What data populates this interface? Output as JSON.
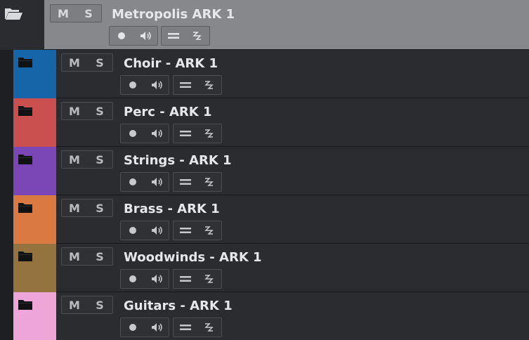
{
  "parent": {
    "name": "Metropolis ARK 1",
    "mute_label": "M",
    "solo_label": "S",
    "icon": "folder-open-icon"
  },
  "tracks": [
    {
      "name": "Choir - ARK 1",
      "mute_label": "M",
      "solo_label": "S",
      "color": "#1565a8",
      "icon": "folder-icon"
    },
    {
      "name": "Perc - ARK 1",
      "mute_label": "M",
      "solo_label": "S",
      "color": "#c9504f",
      "icon": "folder-icon"
    },
    {
      "name": "Strings - ARK 1",
      "mute_label": "M",
      "solo_label": "S",
      "color": "#7b46b5",
      "icon": "folder-icon"
    },
    {
      "name": "Brass - ARK 1",
      "mute_label": "M",
      "solo_label": "S",
      "color": "#da7a42",
      "icon": "folder-icon"
    },
    {
      "name": "Woodwinds - ARK 1",
      "mute_label": "M",
      "solo_label": "S",
      "color": "#95733f",
      "icon": "folder-icon"
    },
    {
      "name": "Guitars - ARK 1",
      "mute_label": "M",
      "solo_label": "S",
      "color": "#eda6d7",
      "icon": "folder-icon"
    }
  ],
  "colors": {
    "parent_bg": "#86888b",
    "row_bg": "#2a2c30",
    "text": "#e6e7e9",
    "button_text": "#b9bbbf"
  }
}
